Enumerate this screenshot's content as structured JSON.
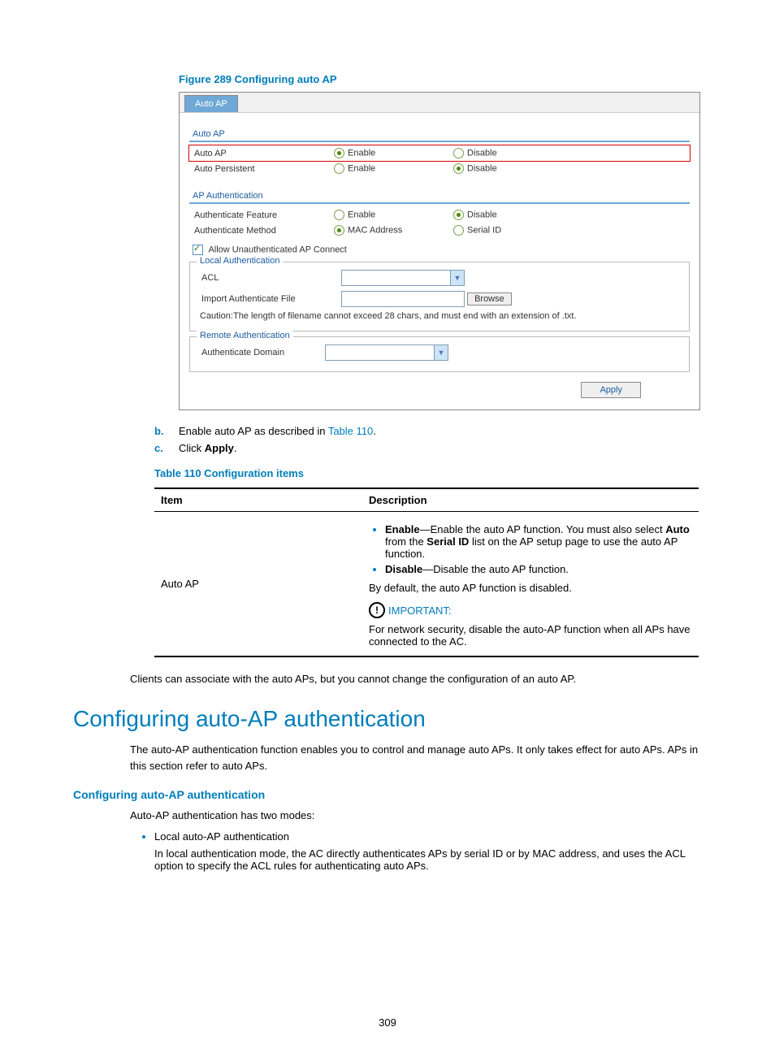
{
  "figure_caption": "Figure 289 Configuring auto AP",
  "screenshot": {
    "tab": "Auto AP",
    "section1_title": "Auto AP",
    "row_auto_ap": {
      "label": "Auto AP",
      "opt1": "Enable",
      "opt2": "Disable"
    },
    "row_auto_persist": {
      "label": "Auto Persistent",
      "opt1": "Enable",
      "opt2": "Disable"
    },
    "section2_title": "AP Authentication",
    "row_auth_feature": {
      "label": "Authenticate Feature",
      "opt1": "Enable",
      "opt2": "Disable"
    },
    "row_auth_method": {
      "label": "Authenticate Method",
      "opt1": "MAC  Address",
      "opt2": "Serial ID"
    },
    "checkbox_allow": "Allow Unauthenticated AP Connect",
    "local_auth_legend": "Local Authentication",
    "acl_label": "ACL",
    "import_label": "Import Authenticate File",
    "browse_btn": "Browse",
    "caution": "Caution:The length of filename cannot exceed 28 chars, and must end with an extension of .txt.",
    "remote_auth_legend": "Remote Authentication",
    "auth_domain_label": "Authenticate Domain",
    "apply_btn": "Apply"
  },
  "steps": {
    "b_marker": "b.",
    "b_text_pre": "Enable auto AP as described in ",
    "b_link": "Table 110",
    "b_text_post": ".",
    "c_marker": "c.",
    "c_text_pre": "Click ",
    "c_bold": "Apply",
    "c_text_post": "."
  },
  "table_caption": "Table 110 Configuration items",
  "table": {
    "h1": "Item",
    "h2": "Description",
    "item": "Auto AP",
    "enable_b": "Enable",
    "enable_rest1": "—Enable the auto AP function. You must also select ",
    "enable_auto": "Auto",
    "enable_rest2": " from the ",
    "enable_serial": "Serial ID",
    "enable_rest3": " list on the AP setup page to use the auto AP function.",
    "disable_b": "Disable",
    "disable_rest": "—Disable the auto AP function.",
    "default_text": "By default, the auto AP function is disabled.",
    "important_label": "IMPORTANT:",
    "important_text": "For network security, disable the auto-AP function when all APs have connected to the AC."
  },
  "para_after_table": "Clients can associate with the auto APs, but you cannot change the configuration of an auto AP.",
  "h1": "Configuring auto-AP authentication",
  "h1_para": "The auto-AP authentication function enables you to control and manage auto APs. It only takes effect for auto APs. APs in this section refer to auto APs.",
  "h3": "Configuring auto-AP authentication",
  "h3_intro": "Auto-AP authentication has two modes:",
  "bullet1": "Local auto-AP authentication",
  "bullet1_para": "In local authentication mode, the AC directly authenticates APs by serial ID or by MAC address, and uses the ACL option to specify the ACL rules for authenticating auto APs.",
  "page_number": "309"
}
